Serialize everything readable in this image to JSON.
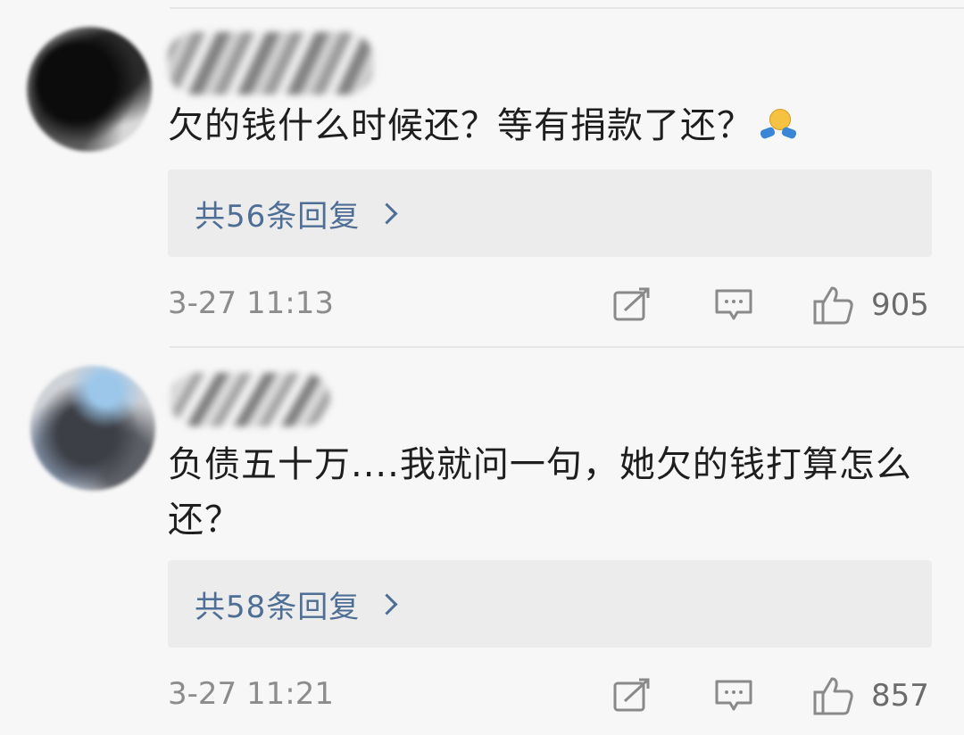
{
  "comments": [
    {
      "text": "欠的钱什么时候还？等有捐款了还？",
      "emoji": "shrug-emoji",
      "replies_label": "共56条回复",
      "timestamp": "3-27 11:13",
      "likes": "905"
    },
    {
      "text": "负债五十万....我就问一句，她欠的钱打算怎么还？",
      "replies_label": "共58条回复",
      "timestamp": "3-27 11:21",
      "likes": "857"
    }
  ],
  "icons": {
    "share": "share-icon",
    "reply": "comment-icon",
    "like": "thumbs-up-icon",
    "chevron": "chevron-right-icon"
  },
  "colors": {
    "link": "#4e6e96",
    "meta": "#8c8c8c",
    "text": "#1e1e1e",
    "reply_box": "#ececec",
    "background": "#f7f7f7"
  }
}
